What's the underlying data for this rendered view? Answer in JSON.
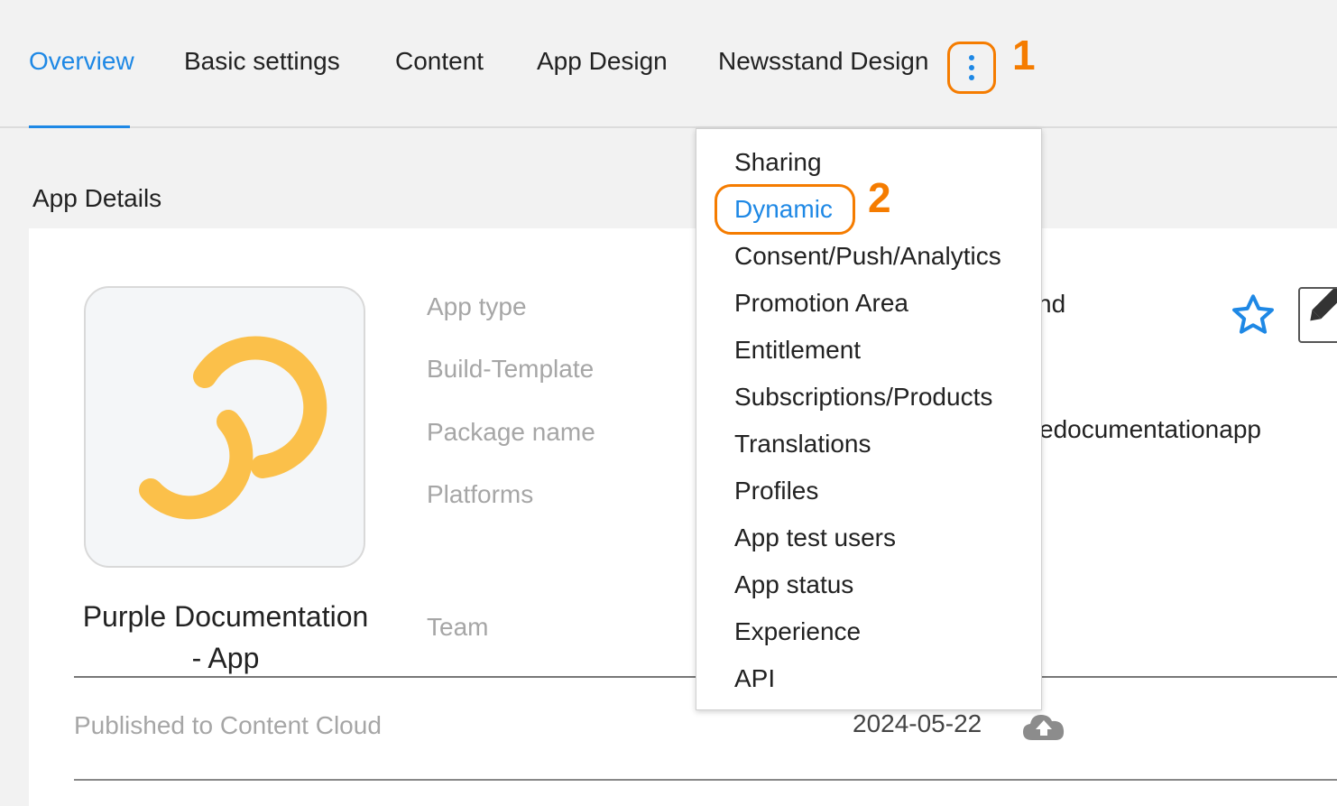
{
  "tabs": {
    "overview": "Overview",
    "basic_settings": "Basic settings",
    "content": "Content",
    "app_design": "App Design",
    "newsstand_design": "Newsstand Design"
  },
  "annotations": {
    "step1": "1",
    "step2": "2"
  },
  "section_title": "App Details",
  "app": {
    "name": "Purple Documentation - App"
  },
  "fields": {
    "app_type_label": "App type",
    "build_template_label": "Build-Template",
    "package_name_label": "Package name",
    "platforms_label": "Platforms",
    "team_label": "Team",
    "app_type_value_partial": "nd",
    "package_name_value_partial": "edocumentationapp"
  },
  "published": {
    "label": "Published to Content Cloud",
    "date": "2024-05-22"
  },
  "menu": {
    "items": [
      "Sharing",
      "Dynamic",
      "Consent/Push/Analytics",
      "Promotion Area",
      "Entitlement",
      "Subscriptions/Products",
      "Translations",
      "Profiles",
      "App test users",
      "App status",
      "Experience",
      "API"
    ]
  },
  "colors": {
    "accent": "#1e88e5",
    "annotation": "#f57c00",
    "logo": "#fbc04a"
  },
  "icons": {
    "more": "kebab-menu-icon",
    "favorite": "star-icon",
    "edit": "pencil-icon",
    "cloud": "cloud-upload-icon",
    "logo": "app-logo-icon"
  }
}
